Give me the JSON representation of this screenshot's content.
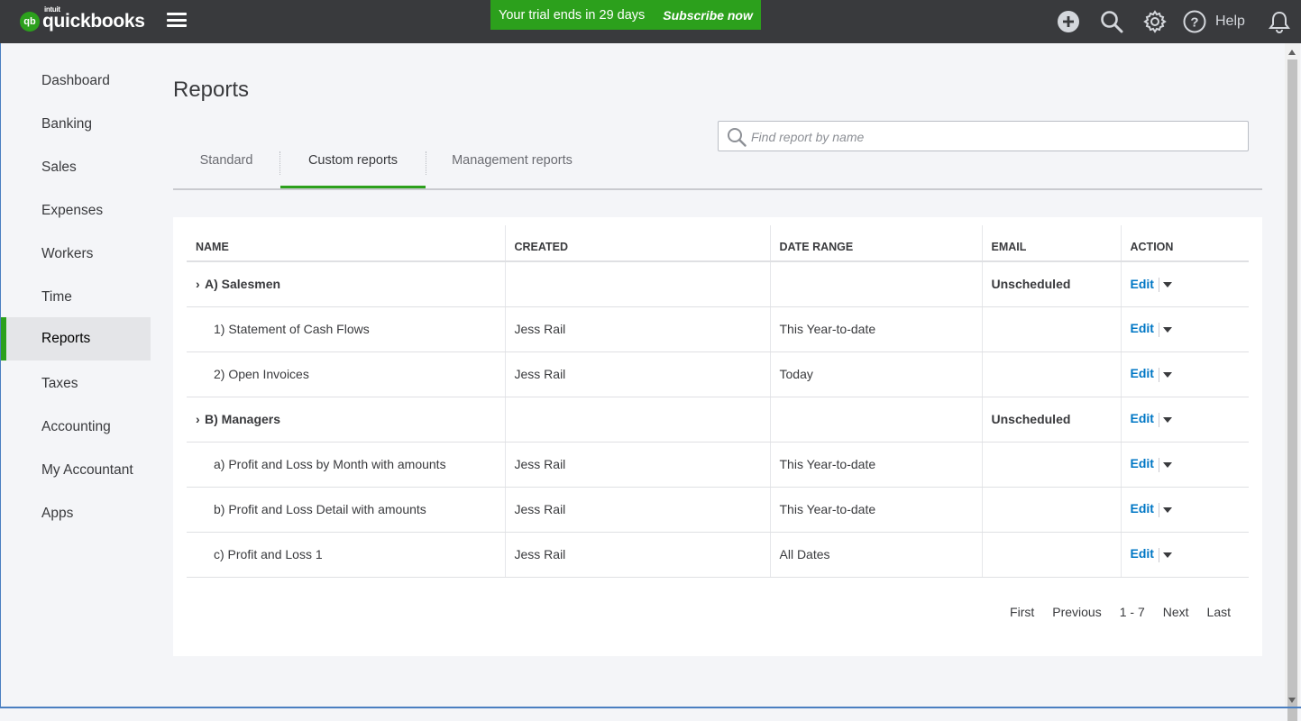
{
  "brand": {
    "mark": "qb",
    "small": "intuit",
    "name": "quickbooks"
  },
  "trial": {
    "text": "Your trial ends in 29 days",
    "cta": "Subscribe now"
  },
  "topbar": {
    "help_label": "Help"
  },
  "sidebar": {
    "items": [
      {
        "label": "Dashboard"
      },
      {
        "label": "Banking"
      },
      {
        "label": "Sales"
      },
      {
        "label": "Expenses"
      },
      {
        "label": "Workers"
      },
      {
        "label": "Time"
      },
      {
        "label": "Reports",
        "active": true
      },
      {
        "label": "Taxes"
      },
      {
        "label": "Accounting"
      },
      {
        "label": "My Accountant"
      },
      {
        "label": "Apps"
      }
    ]
  },
  "page": {
    "title": "Reports"
  },
  "tabs": [
    {
      "label": "Standard"
    },
    {
      "label": "Custom reports",
      "active": true
    },
    {
      "label": "Management reports"
    }
  ],
  "search": {
    "placeholder": "Find report by name",
    "value": ""
  },
  "table": {
    "headers": [
      "NAME",
      "CREATED",
      "DATE RANGE",
      "EMAIL",
      "ACTION"
    ],
    "rows": [
      {
        "type": "group",
        "chevron": "›",
        "name": "A) Salesmen",
        "created": "",
        "range": "",
        "email": "Unscheduled",
        "action": "Edit"
      },
      {
        "type": "child",
        "name": "1) Statement of Cash Flows",
        "created": "Jess Rail",
        "range": "This Year-to-date",
        "email": "",
        "action": "Edit"
      },
      {
        "type": "child",
        "name": "2) Open Invoices",
        "created": "Jess Rail",
        "range": "Today",
        "email": "",
        "action": "Edit"
      },
      {
        "type": "group",
        "chevron": "›",
        "name": "B) Managers",
        "created": "",
        "range": "",
        "email": "Unscheduled",
        "action": "Edit"
      },
      {
        "type": "child",
        "name": "a) Profit and Loss by Month with amounts",
        "created": "Jess Rail",
        "range": "This Year-to-date",
        "email": "",
        "action": "Edit"
      },
      {
        "type": "child",
        "name": "b) Profit and Loss Detail with amounts",
        "created": "Jess Rail",
        "range": "This Year-to-date",
        "email": "",
        "action": "Edit"
      },
      {
        "type": "child",
        "name": "c) Profit and Loss 1",
        "created": "Jess Rail",
        "range": "All Dates",
        "email": "",
        "action": "Edit"
      }
    ]
  },
  "pager": {
    "first": "First",
    "previous": "Previous",
    "info": "1 - 7",
    "next": "Next",
    "last": "Last"
  },
  "colors": {
    "brand_green": "#2ca01c",
    "topbar": "#393a3d",
    "link_blue": "#0077c5"
  }
}
